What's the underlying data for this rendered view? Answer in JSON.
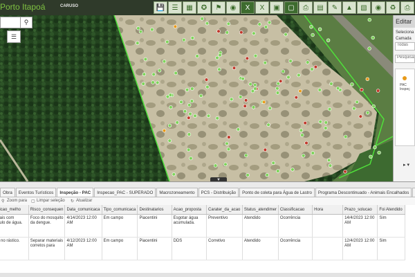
{
  "header": {
    "brand": "Porto Itapoá",
    "user": "CARUSO",
    "tool_icons": [
      "save-icon",
      "list-icon",
      "grid-icon",
      "compass-icon",
      "tag-icon",
      "globe-icon",
      "excel-icon",
      "excel-icon",
      "image-icon",
      "screen-icon",
      "print-icon",
      "report-icon",
      "pencil-icon",
      "pdf-icon",
      "file-icon",
      "map-pin-icon",
      "recycle-icon",
      "print-icon"
    ],
    "colors": {
      "bar": "#2f3a2a",
      "brand": "#7fc242"
    }
  },
  "map": {
    "controls": {
      "search": "search-icon",
      "layers": "layers-icon"
    },
    "colors": {
      "green_point": "#7ed35a",
      "red_point": "#c0392b",
      "orange_point": "#e89a1a",
      "boundary": "#4fe03a"
    }
  },
  "edit_panel": {
    "title": "Editar",
    "select_label": "Seleciona",
    "layer_label": "Camada",
    "layer_value": "Todas",
    "search_placeholder": "Pesquisa",
    "card_text_1": "PAC",
    "card_text_2": "Inspeç"
  },
  "tabs": [
    {
      "label": "Obra",
      "active": false
    },
    {
      "label": "Eventos Turísticos",
      "active": false
    },
    {
      "label": "Inspeção - PAC",
      "active": true
    },
    {
      "label": "Inspecao_PAC - SUPERADO",
      "active": false
    },
    {
      "label": "Macrozoneamento",
      "active": false
    },
    {
      "label": "PCS - Distribuição",
      "active": false
    },
    {
      "label": "Ponto de coleta para Água de Lastro",
      "active": false
    },
    {
      "label": "Programa Descontinuado - Animais Encalhados",
      "active": false
    },
    {
      "label": "Pr",
      "active": false
    }
  ],
  "grid_toolbar": {
    "zoom": "Zoom para",
    "clear": "Limpar seleção",
    "refresh": "Atualizar"
  },
  "table": {
    "columns": [
      "escricao_melho",
      "Risco_consequen",
      "Data_comunicaca",
      "Tipo_comunicaca",
      "Destinatarios",
      "Acao_proposta",
      "Carater_da_acao",
      "Status_atendimer",
      "Classificacao",
      "Hora",
      "Prazo_solucao",
      "Foi Atendido"
    ],
    "rows": [
      [
        "ateriais com cúmulo de água.",
        "Foco do mosquito da dengue.",
        "4/14/2023 12:00 AM",
        "Em campo",
        "Piacentini",
        "Esgotar água acumulada.",
        "Preventivo",
        "Atendido",
        "Ocorrência",
        "",
        "14/4/2023 12:00 AM",
        "Sim"
      ],
      [
        "apel no rástico.",
        "Separar materiais corretos para",
        "4/12/2023 12:00 AM",
        "Em campo",
        "Piacentini",
        "DDS",
        "Corretivo",
        "Atendido",
        "Ocorrência",
        "",
        "12/4/2023 12:00 AM",
        "Sim"
      ]
    ]
  }
}
